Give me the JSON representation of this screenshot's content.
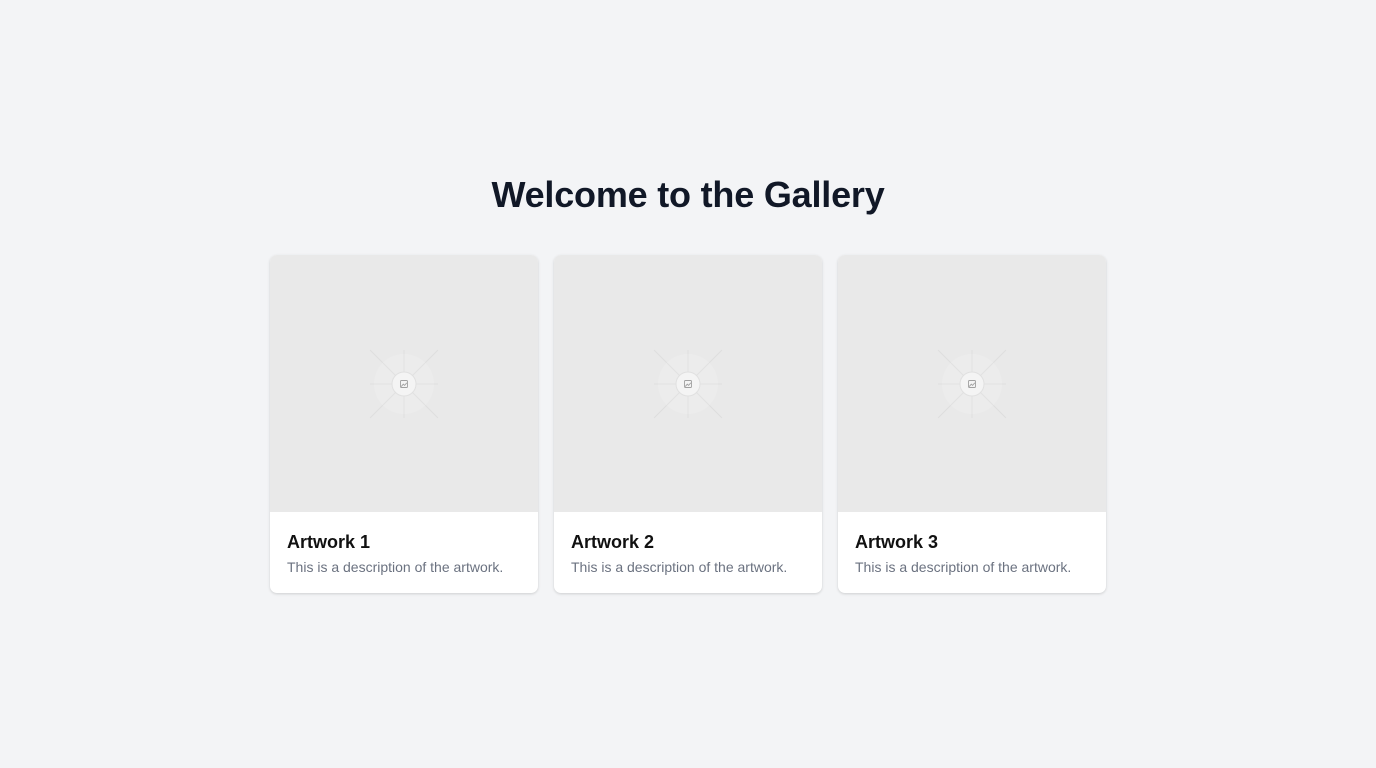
{
  "page": {
    "title": "Welcome to the Gallery"
  },
  "gallery": {
    "items": [
      {
        "title": "Artwork 1",
        "description": "This is a description of the artwork.",
        "image_icon": "image-placeholder-icon"
      },
      {
        "title": "Artwork 2",
        "description": "This is a description of the artwork.",
        "image_icon": "image-placeholder-icon"
      },
      {
        "title": "Artwork 3",
        "description": "This is a description of the artwork.",
        "image_icon": "image-placeholder-icon"
      }
    ]
  },
  "colors": {
    "background": "#f3f4f6",
    "card": "#ffffff",
    "image_placeholder": "#e9e9e9",
    "title_text": "#111827",
    "description_text": "#6b7280"
  }
}
